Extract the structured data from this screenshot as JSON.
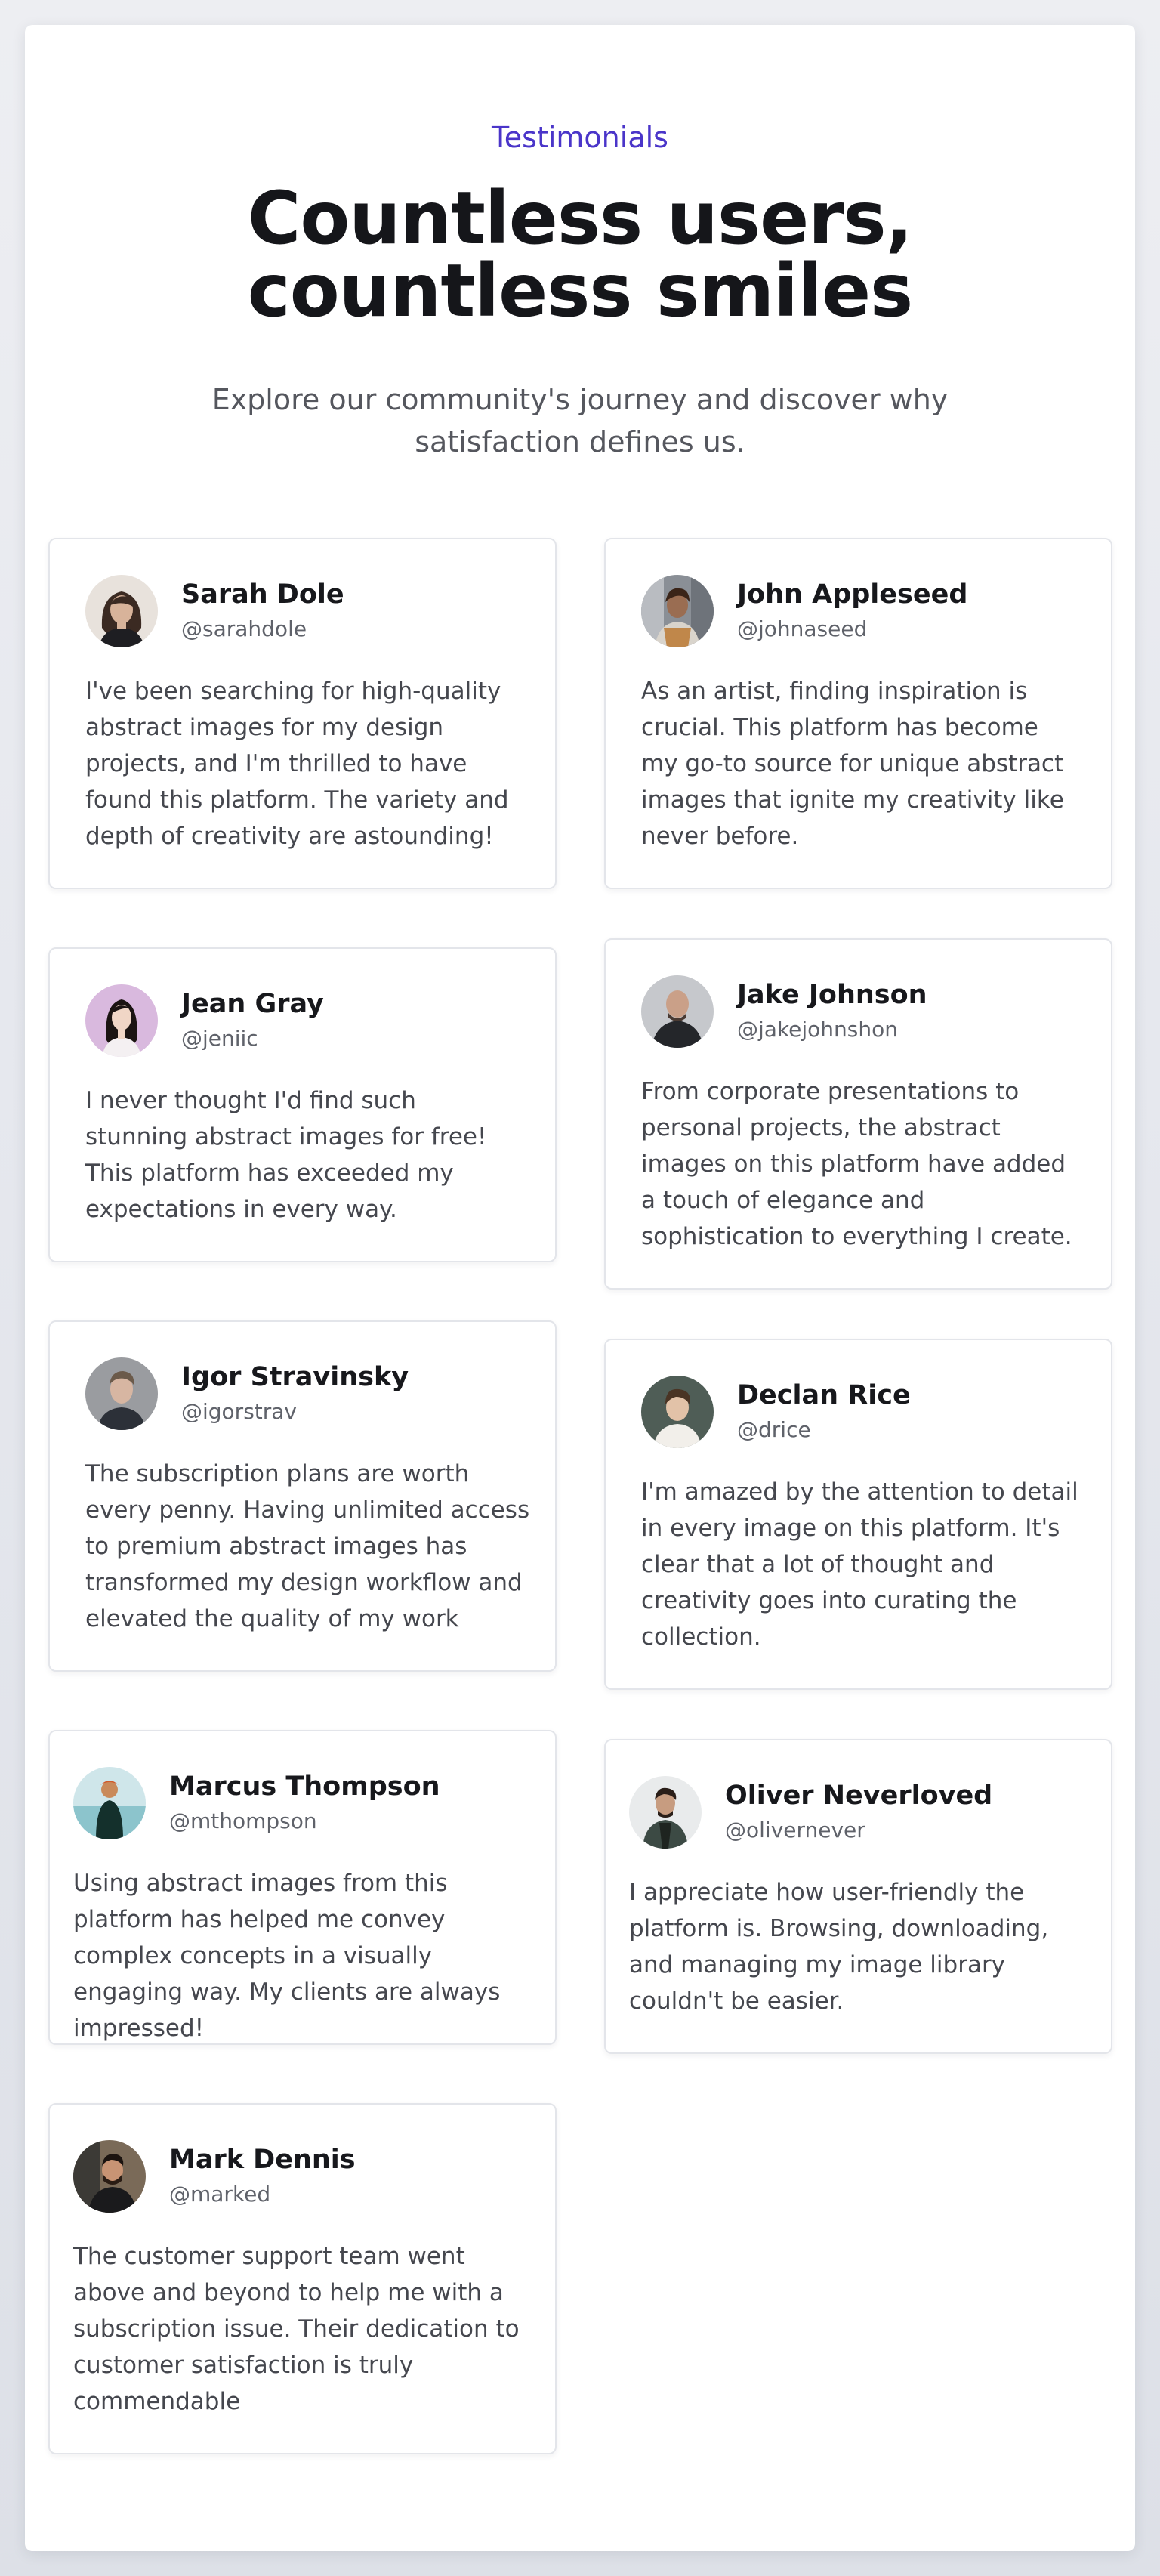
{
  "header": {
    "eyebrow": "Testimonials",
    "title": "Countless users, countless smiles",
    "subtitle": "Explore our community's journey and discover why satisfaction defines us."
  },
  "colors": {
    "accent": "#4a35c9",
    "card_border": "#e3e5ea",
    "text": "#17181c",
    "muted": "#5f626a"
  },
  "testimonials": [
    {
      "name": "Sarah Dole",
      "handle": "@sarahdole",
      "quote": "I've been searching for high-quality abstract images for my design projects, and I'm thrilled to have found this platform. The variety and depth of creativity are astounding!",
      "avatar_icon": "woman-portrait-avatar"
    },
    {
      "name": "John Appleseed",
      "handle": "@johnaseed",
      "quote": "As an artist, finding inspiration is crucial. This platform has become my go-to source for unique abstract images that ignite my creativity like never before.",
      "avatar_icon": "man-portrait-avatar"
    },
    {
      "name": "Jean Gray",
      "handle": "@jeniic",
      "quote": "I never thought I'd find such stunning abstract images for free! This platform has exceeded my expectations in every way.",
      "avatar_icon": "woman-portrait-avatar"
    },
    {
      "name": "Jake Johnson",
      "handle": "@jakejohnshon",
      "quote": "From corporate presentations to personal projects, the abstract images on this platform have added a touch of elegance and sophistication to everything I create.",
      "avatar_icon": "man-portrait-avatar"
    },
    {
      "name": "Igor Stravinsky",
      "handle": "@igorstrav",
      "quote": "The subscription plans are worth every penny. Having unlimited access to premium abstract images has transformed my design workflow and elevated the quality of my work",
      "avatar_icon": "man-portrait-avatar"
    },
    {
      "name": "Declan Rice",
      "handle": "@drice",
      "quote": "I'm amazed by the attention to detail in every image on this platform. It's clear that a lot of thought and creativity goes into curating the collection.",
      "avatar_icon": "man-portrait-avatar"
    },
    {
      "name": "Marcus Thompson",
      "handle": "@mthompson",
      "quote": "Using abstract images from this platform has helped me convey complex concepts in a visually engaging way. My clients are always impressed!",
      "avatar_icon": "man-portrait-avatar"
    },
    {
      "name": "Oliver Neverloved",
      "handle": "@olivernever",
      "quote": "I appreciate how user-friendly the platform is. Browsing, downloading, and managing my image library couldn't be easier.",
      "avatar_icon": "man-portrait-avatar"
    },
    {
      "name": "Mark Dennis",
      "handle": "@marked",
      "quote": "The customer support team went above and beyond to help me with a subscription issue. Their dedication to customer satisfaction is truly commendable",
      "avatar_icon": "man-portrait-avatar"
    }
  ]
}
